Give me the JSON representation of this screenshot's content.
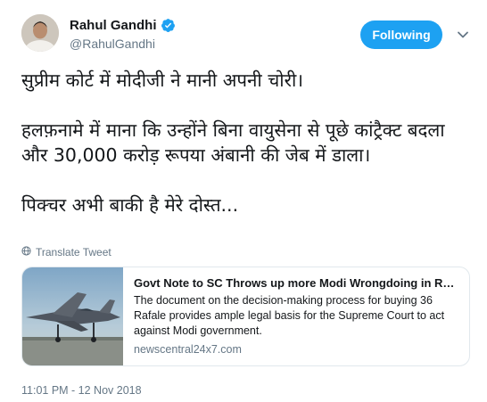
{
  "author": {
    "name": "Rahul Gandhi",
    "handle": "@RahulGandhi",
    "verified_icon": "verified-badge-icon"
  },
  "follow_button": {
    "label": "Following"
  },
  "menu": {
    "icon": "chevron-down-icon"
  },
  "tweet": {
    "paragraphs": [
      "सुप्रीम कोर्ट में मोदीजी ने मानी अपनी चोरी।",
      "हलफ़नामे में माना कि उन्होंने बिना वायुसेना से पूछे कांट्रैक्ट बदला और 30,000 करोड़ रूपया अंबानी की जेब में डाला।",
      "पिक्चर अभी बाकी है मेरे दोस्त..."
    ]
  },
  "translate": {
    "label": "Translate Tweet",
    "icon": "globe-icon"
  },
  "card": {
    "title": "Govt Note to SC Throws up more Modi Wrongdoing in Rafale Deal",
    "description": "The document on the decision-making process for buying 36 Rafale provides ample legal basis for the Supreme Court to act against Modi government.",
    "domain": "newscentral24x7.com",
    "image_icon": "fighter-jet-image"
  },
  "timestamp": "11:01 PM - 12 Nov 2018",
  "colors": {
    "accent": "#1da1f2",
    "secondary_text": "#657786",
    "border": "#e1e8ed"
  }
}
